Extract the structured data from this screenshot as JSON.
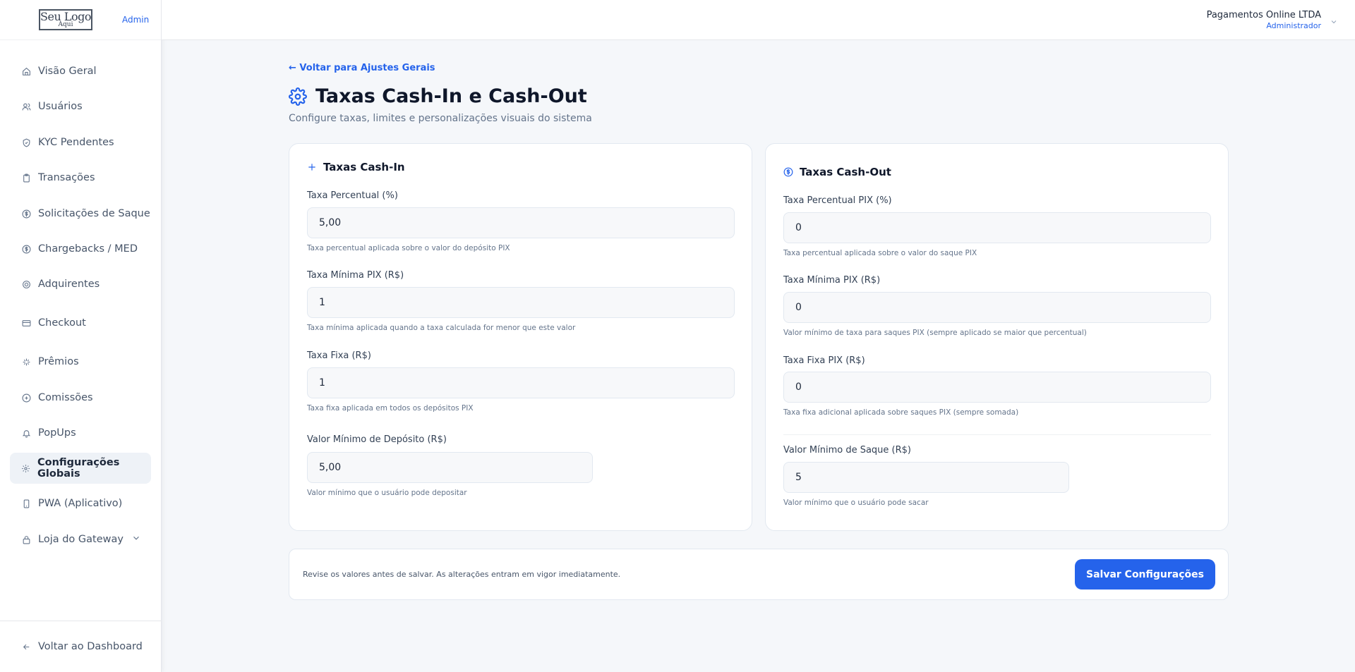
{
  "brand": {
    "logo_main": "Seu Logo",
    "logo_sub": "Aqui",
    "role_tag": "Admin"
  },
  "sidebar": {
    "items": [
      {
        "label": "Visão Geral",
        "icon": "home-icon"
      },
      {
        "label": "Usuários",
        "icon": "users-icon"
      },
      {
        "label": "KYC Pendentes",
        "icon": "shield-icon"
      },
      {
        "label": "Transações",
        "icon": "clipboard-icon"
      },
      {
        "label": "Solicitações de Saque",
        "icon": "dollar-circle-icon"
      },
      {
        "label": "Chargebacks / MED",
        "icon": "dollar-circle-icon"
      },
      {
        "label": "Adquirentes",
        "icon": "target-icon"
      },
      {
        "label": "Checkout",
        "icon": "card-icon"
      },
      {
        "label": "Prêmios",
        "icon": "sparkle-icon"
      },
      {
        "label": "Comissões",
        "icon": "coin-icon"
      },
      {
        "label": "PopUps",
        "icon": "bell-icon"
      },
      {
        "label": "Configurações Globais",
        "icon": "gear-icon",
        "active": true
      },
      {
        "label": "PWA (Aplicativo)",
        "icon": "phone-icon"
      },
      {
        "label": "Loja do Gateway",
        "icon": "lock-icon",
        "expandable": true
      }
    ],
    "footer_label": "Voltar ao Dashboard"
  },
  "header": {
    "company": "Pagamentos Online LTDA",
    "role": "Administrador"
  },
  "main": {
    "back_link": "← Voltar para Ajustes Gerais",
    "title": "Taxas Cash-In e Cash-Out",
    "subtitle": "Configure taxas, limites e personalizações visuais do sistema"
  },
  "cash_in": {
    "title": "Taxas Cash-In",
    "fields": [
      {
        "label": "Taxa Percentual (%)",
        "value": "5,00",
        "hint": "Taxa percentual aplicada sobre o valor do depósito PIX"
      },
      {
        "label": "Taxa Mínima PIX (R$)",
        "value": "1",
        "hint": "Taxa mínima aplicada quando a taxa calculada for menor que este valor"
      },
      {
        "label": "Taxa Fixa (R$)",
        "value": "1",
        "hint": "Taxa fixa aplicada em todos os depósitos PIX"
      },
      {
        "label": "Valor Mínimo de Depósito (R$)",
        "value": "5,00",
        "hint": "Valor mínimo que o usuário pode depositar"
      }
    ]
  },
  "cash_out": {
    "title": "Taxas Cash-Out",
    "fields": [
      {
        "label": "Taxa Percentual PIX (%)",
        "value": "0",
        "hint": "Taxa percentual aplicada sobre o valor do saque PIX"
      },
      {
        "label": "Taxa Mínima PIX (R$)",
        "value": "0",
        "hint": "Valor mínimo de taxa para saques PIX (sempre aplicado se maior que percentual)"
      },
      {
        "label": "Taxa Fixa PIX (R$)",
        "value": "0",
        "hint": "Taxa fixa adicional aplicada sobre saques PIX (sempre somada)"
      },
      {
        "label": "Valor Mínimo de Saque (R$)",
        "value": "5",
        "hint": "Valor mínimo que o usuário pode sacar"
      }
    ]
  },
  "footer": {
    "note": "Revise os valores antes de salvar. As alterações entram em vigor imediatamente.",
    "save_label": "Salvar Configurações"
  },
  "colors": {
    "accent": "#2563eb",
    "background": "#f5f7fa",
    "active_item": "#eef2f7"
  }
}
